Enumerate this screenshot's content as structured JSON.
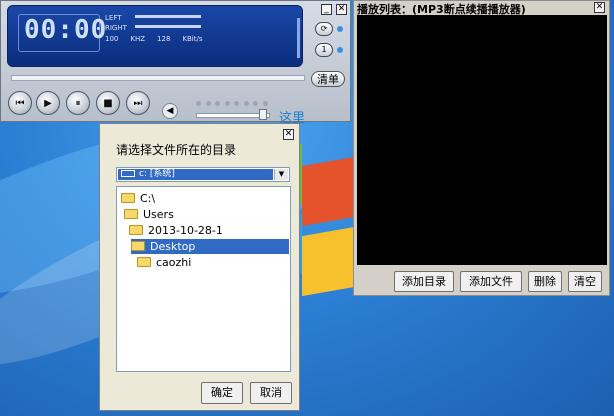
{
  "player": {
    "time": "00:00",
    "labels": {
      "left": "LEFT",
      "right": "RIGHT"
    },
    "info": {
      "freq": "100",
      "freq_unit": "KHZ",
      "bitrate": "128",
      "bitrate_unit": "KBit/s"
    },
    "controls": {
      "prev": "⏮",
      "play": "▶",
      "pause": "⏸",
      "stop": "■",
      "next": "⏭"
    },
    "playlist_button": "清单",
    "volume_icon": "speaker-icon",
    "volume_level": 0.88,
    "progress_level": 0,
    "here_label": "这里",
    "minimize": "_",
    "close": "✕"
  },
  "playlist": {
    "title": "播放列表：(MP3断点续播播放器)",
    "close": "✕",
    "buttons": {
      "add_dir": "添加目录",
      "add_file": "添加文件",
      "delete": "删除",
      "clear": "清空"
    }
  },
  "dialog": {
    "title": "请选择文件所在的目录",
    "close": "✕",
    "drive": "c: [系统]",
    "tree": [
      {
        "label": "C:\\",
        "selected": false
      },
      {
        "label": "Users",
        "selected": false
      },
      {
        "label": "2013-10-28-1",
        "selected": false
      },
      {
        "label": "Desktop",
        "selected": true
      },
      {
        "label": "caozhi",
        "selected": false
      }
    ],
    "ok": "确定",
    "cancel": "取消"
  },
  "colors": {
    "selection": "#316ac5",
    "display_bg": "#0b2d7c",
    "here_text": "#1a7fd0"
  }
}
